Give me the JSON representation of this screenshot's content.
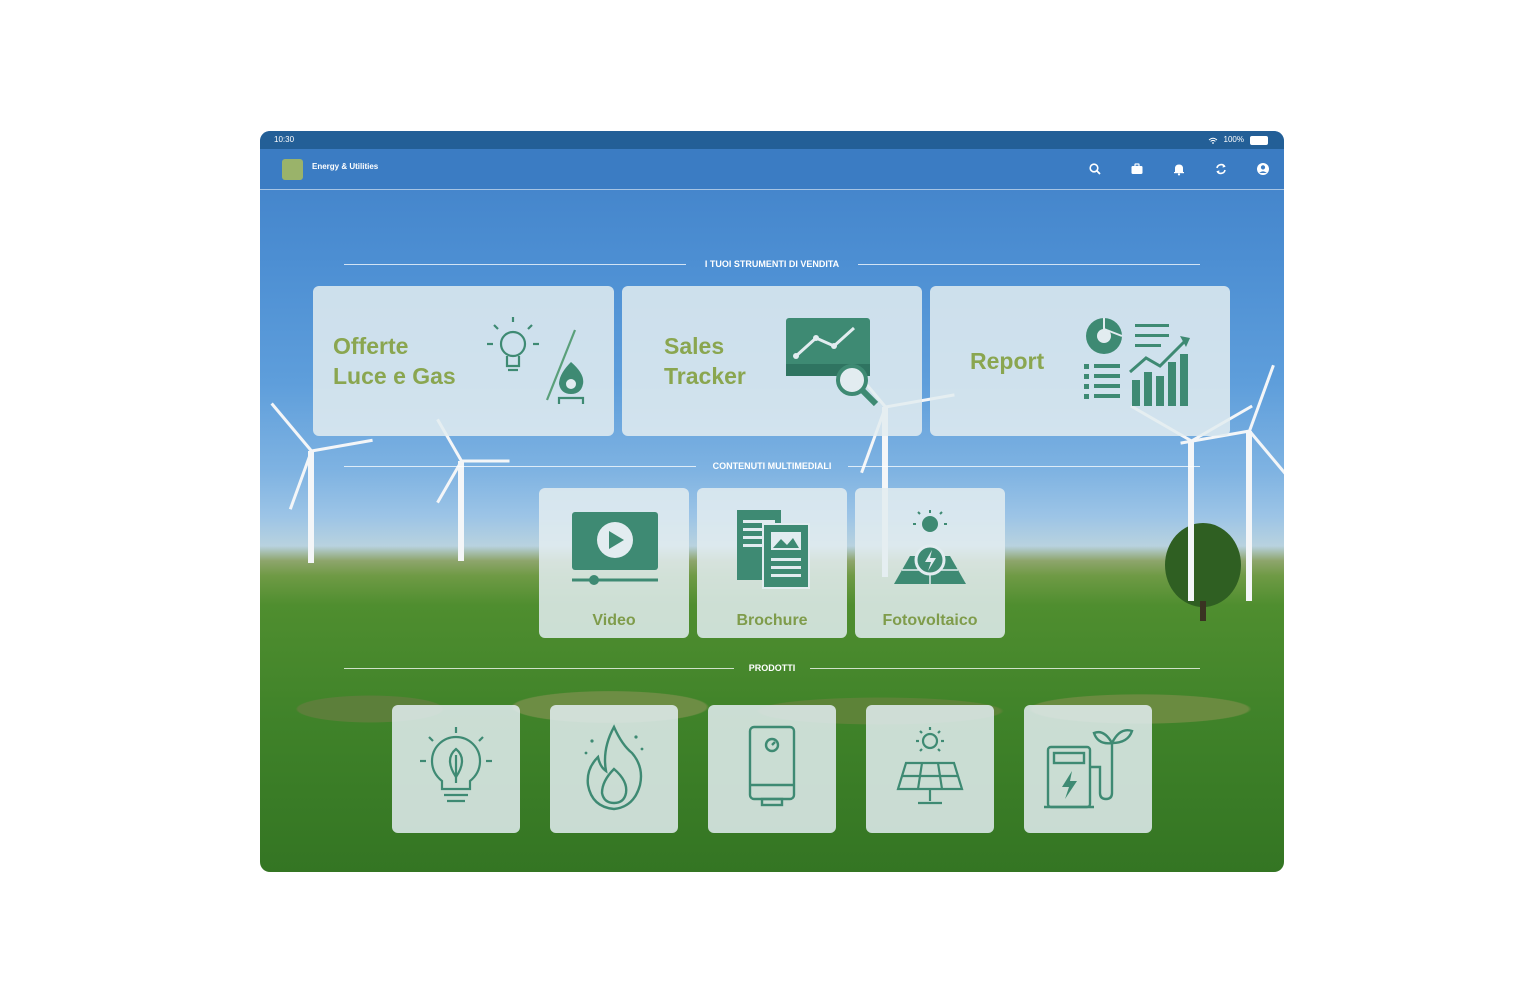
{
  "status_bar": {
    "time": "10:30",
    "battery": "100%"
  },
  "navbar": {
    "title": "Energy & Utilities",
    "icons": [
      "search-icon",
      "briefcase-icon",
      "bell-icon",
      "sync-icon",
      "account-icon"
    ]
  },
  "sections": {
    "tools": "I TUOI STRUMENTI DI VENDITA",
    "media": "CONTENUTI MULTIMEDIALI",
    "products": "PRODOTTI"
  },
  "tools": [
    {
      "line1": "Offerte",
      "line2": "Luce e Gas"
    },
    {
      "line1": "Sales",
      "line2": "Tracker"
    },
    {
      "line1": "Report",
      "line2": ""
    }
  ],
  "media": [
    {
      "label": "Video"
    },
    {
      "label": "Brochure"
    },
    {
      "label": "Fotovoltaico"
    }
  ],
  "products": [
    {
      "icon": "eco-bulb-icon"
    },
    {
      "icon": "flame-icon"
    },
    {
      "icon": "boiler-icon"
    },
    {
      "icon": "solar-panel-icon"
    },
    {
      "icon": "ev-charger-icon"
    }
  ],
  "colors": {
    "accent_green": "#8aa650",
    "icon_teal": "#3e8a73",
    "nav_blue": "#3b7cc3"
  }
}
